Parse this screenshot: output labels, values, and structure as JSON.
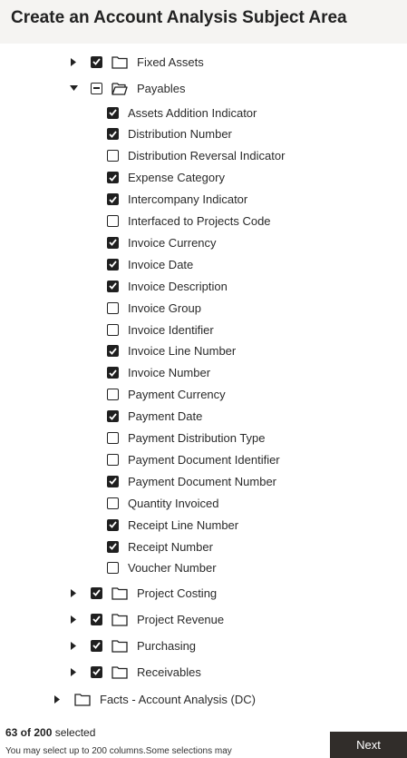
{
  "header": {
    "title": "Create an Account Analysis Subject Area"
  },
  "tree": {
    "fixed_assets": {
      "label": "Fixed Assets",
      "checked": true
    },
    "payables": {
      "label": "Payables"
    },
    "payables_items": [
      {
        "label": "Assets Addition Indicator",
        "checked": true
      },
      {
        "label": "Distribution Number",
        "checked": true
      },
      {
        "label": "Distribution Reversal Indicator",
        "checked": false
      },
      {
        "label": "Expense Category",
        "checked": true
      },
      {
        "label": "Intercompany Indicator",
        "checked": true
      },
      {
        "label": "Interfaced to Projects Code",
        "checked": false
      },
      {
        "label": "Invoice Currency",
        "checked": true
      },
      {
        "label": "Invoice Date",
        "checked": true
      },
      {
        "label": "Invoice Description",
        "checked": true
      },
      {
        "label": "Invoice Group",
        "checked": false
      },
      {
        "label": "Invoice Identifier",
        "checked": false
      },
      {
        "label": "Invoice Line Number",
        "checked": true
      },
      {
        "label": "Invoice Number",
        "checked": true
      },
      {
        "label": "Payment Currency",
        "checked": false
      },
      {
        "label": "Payment Date",
        "checked": true
      },
      {
        "label": "Payment Distribution Type",
        "checked": false
      },
      {
        "label": "Payment Document Identifier",
        "checked": false
      },
      {
        "label": "Payment Document Number",
        "checked": true
      },
      {
        "label": "Quantity Invoiced",
        "checked": false
      },
      {
        "label": "Receipt Line Number",
        "checked": true
      },
      {
        "label": "Receipt Number",
        "checked": true
      },
      {
        "label": "Voucher Number",
        "checked": false
      }
    ],
    "project_costing": {
      "label": "Project Costing",
      "checked": true
    },
    "project_revenue": {
      "label": "Project Revenue",
      "checked": true
    },
    "purchasing": {
      "label": "Purchasing",
      "checked": true
    },
    "receivables": {
      "label": "Receivables",
      "checked": true
    },
    "facts": {
      "label": "Facts - Account Analysis (DC)"
    }
  },
  "footer": {
    "count": "63 of 200",
    "count_suffix": " selected",
    "note": "You may select up to 200 columns.Some selections may",
    "next_label": "Next"
  },
  "icons": [
    "expand-arrow-icon",
    "collapse-arrow-icon",
    "folder-icon",
    "folder-open-icon",
    "checkbox-icon"
  ]
}
